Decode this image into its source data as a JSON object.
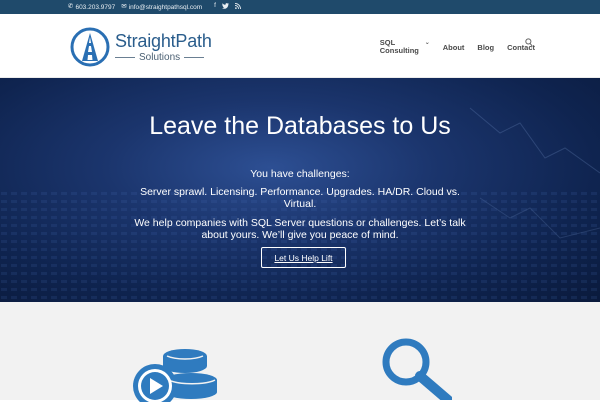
{
  "topbar": {
    "phone": "603.203.9797",
    "email": "info@straightpathsql.com",
    "social": [
      {
        "name": "facebook-icon",
        "glyph": "f"
      },
      {
        "name": "twitter-icon",
        "glyph": "t"
      },
      {
        "name": "rss-icon",
        "glyph": "r"
      }
    ]
  },
  "logo": {
    "title": "StraightPath",
    "subtitle": "Solutions"
  },
  "nav": {
    "sql_consulting": "SQL Consulting",
    "about": "About",
    "blog": "Blog",
    "contact": "Contact"
  },
  "hero": {
    "title": "Leave the Databases to Us",
    "subtitle": "You have challenges:",
    "challenges": "Server sprawl. Licensing. Performance. Upgrades. HA/DR. Cloud vs. Virtual.",
    "description": "We help companies with SQL Server questions or challenges. Let’s talk about yours. We’ll give you peace of mind.",
    "button": "Let Us Help Lift"
  },
  "colors": {
    "topbar": "#1f4a6b",
    "brand": "#2a5d8c",
    "feature_icon": "#2f7bbf"
  }
}
